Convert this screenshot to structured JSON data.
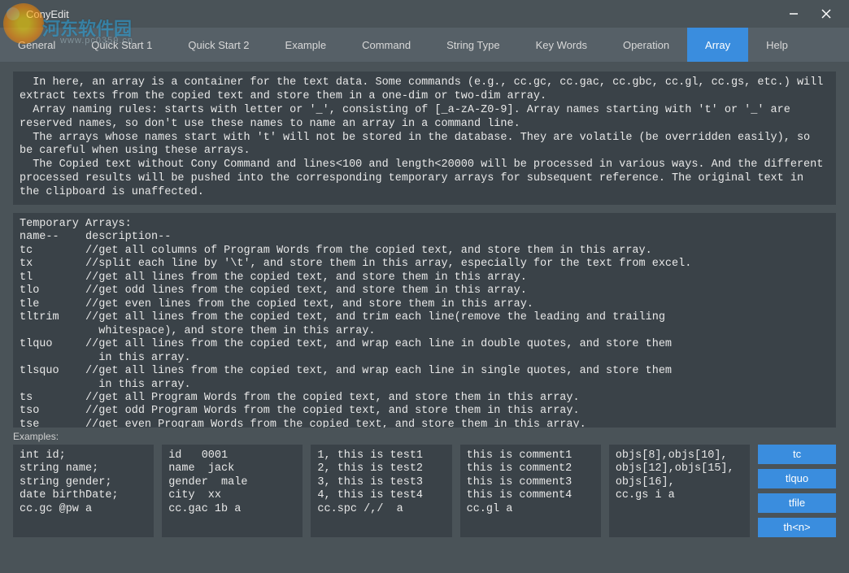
{
  "titlebar": {
    "app_name": "ConyEdit"
  },
  "watermark": {
    "title": "河东软件园",
    "subtitle": "www.pc0359.cn"
  },
  "tabs": [
    {
      "label": "General"
    },
    {
      "label": "Quick Start 1"
    },
    {
      "label": "Quick Start 2"
    },
    {
      "label": "Example"
    },
    {
      "label": "Command"
    },
    {
      "label": "String Type"
    },
    {
      "label": "Key Words"
    },
    {
      "label": "Operation"
    },
    {
      "label": "Array"
    },
    {
      "label": "Help"
    }
  ],
  "active_tab": "Array",
  "info_text": "  In here, an array is a container for the text data. Some commands (e.g., cc.gc, cc.gac, cc.gbc, cc.gl, cc.gs, etc.) will extract texts from the copied text and store them in a one-dim or two-dim array.\n  Array naming rules: starts with letter or '_', consisting of [_a-zA-Z0-9]. Array names starting with 't' or '_' are reserved names, so don't use these names to name an array in a command line.\n  The arrays whose names start with 't' will not be stored in the database. They are volatile (be overridden easily), so be careful when using these arrays.\n  The Copied text without Cony Command and lines<100 and length<20000 will be processed in various ways. And the different processed results will be pushed into the corresponding temporary arrays for subsequent reference. The original text in the clipboard is unaffected.",
  "main_text": "Temporary Arrays:\nname--    description--\ntc        //get all columns of Program Words from the copied text, and store them in this array.\ntx        //split each line by '\\t', and store them in this array, especially for the text from excel.\ntl        //get all lines from the copied text, and store them in this array.\ntlo       //get odd lines from the copied text, and store them in this array.\ntle       //get even lines from the copied text, and store them in this array.\ntltrim    //get all lines from the copied text, and trim each line(remove the leading and trailing\n            whitespace), and store them in this array.\ntlquo     //get all lines from the copied text, and wrap each line in double quotes, and store them\n            in this array.\ntlsquo    //get all lines from the copied text, and wrap each line in single quotes, and store them\n            in this array.\nts        //get all Program Words from the copied text, and store them in this array.\ntso       //get odd Program Words from the copied text, and store them in this array.\ntse       //get even Program Words from the copied text, and store them in this array.\ntfile     //when user copy some files, the names and the paths of the files will be stored",
  "examples_label": "Examples:",
  "examples": [
    "int id;\nstring name;\nstring gender;\ndate birthDate;\ncc.gc @pw a",
    "id   0001\nname  jack\ngender  male\ncity  xx\ncc.gac 1b a",
    "1, this is test1\n2, this is test2\n3, this is test3\n4, this is test4\ncc.spc /,/  a",
    "this is comment1\nthis is comment2\nthis is comment3\nthis is comment4\ncc.gl a",
    "objs[8],objs[10],\nobjs[12],objs[15],\nobjs[16],\ncc.gs i a"
  ],
  "example_buttons": [
    "tc",
    "tlquo",
    "tfile",
    "th<n>"
  ]
}
